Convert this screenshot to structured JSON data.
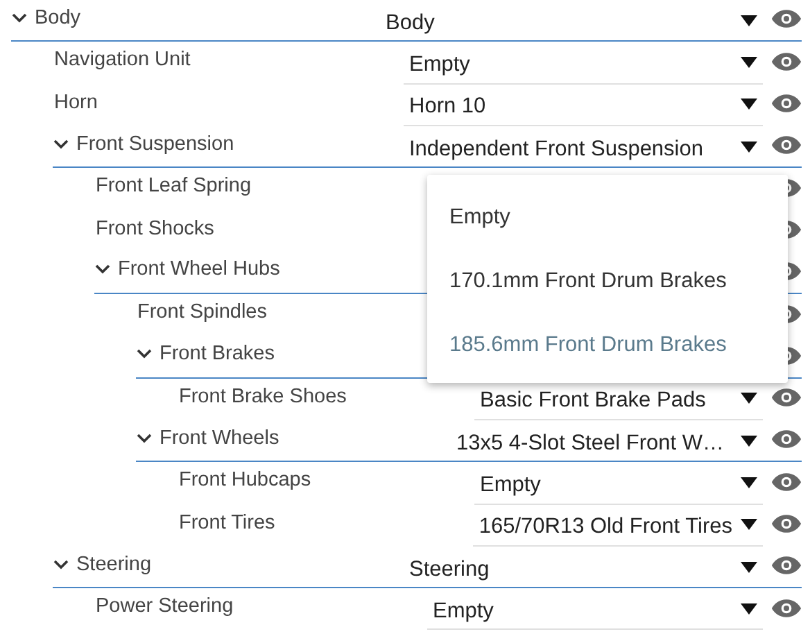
{
  "tree": [
    {
      "label": "Body",
      "value": "Body",
      "expanded": true,
      "children": [
        {
          "label": "Navigation Unit",
          "value": "Empty"
        },
        {
          "label": "Horn",
          "value": "Horn 10"
        },
        {
          "label": "Front Suspension",
          "value": "Independent Front Suspension",
          "expanded": true,
          "children": [
            {
              "label": "Front Leaf Spring"
            },
            {
              "label": "Front Shocks"
            },
            {
              "label": "Front Wheel Hubs",
              "expanded": true,
              "children": [
                {
                  "label": "Front Spindles"
                },
                {
                  "label": "Front Brakes",
                  "expanded": true,
                  "children": [
                    {
                      "label": "Front Brake Shoes",
                      "value": "Basic Front Brake Pads"
                    }
                  ]
                },
                {
                  "label": "Front Wheels",
                  "value": "13x5 4-Slot Steel Front W…",
                  "expanded": true,
                  "children": [
                    {
                      "label": "Front Hubcaps",
                      "value": "Empty"
                    },
                    {
                      "label": "Front Tires",
                      "value": "165/70R13 Old Front Tires"
                    }
                  ]
                }
              ]
            }
          ]
        },
        {
          "label": "Steering",
          "value": "Steering",
          "expanded": true,
          "children": [
            {
              "label": "Power Steering",
              "value": "Empty"
            }
          ]
        }
      ]
    }
  ],
  "open_menu": {
    "options": [
      {
        "label": "Empty",
        "selected": false
      },
      {
        "label": "170.1mm Front Drum Brakes",
        "selected": false
      },
      {
        "label": "185.6mm Front Drum Brakes",
        "selected": true
      }
    ]
  }
}
